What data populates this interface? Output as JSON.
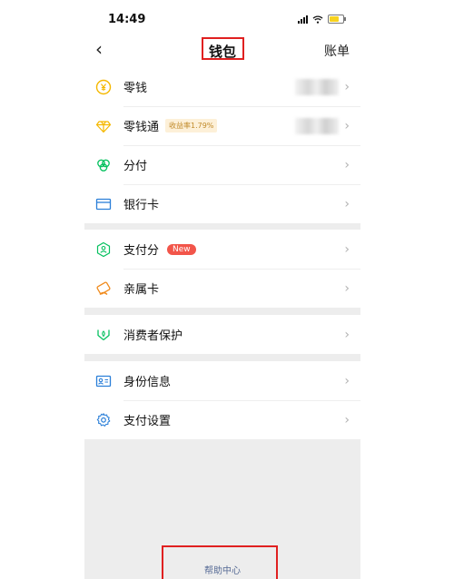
{
  "status_bar": {
    "time": "14:49"
  },
  "nav": {
    "back": "‹",
    "title": "钱包",
    "right": "账单"
  },
  "chevron": "›",
  "sections": [
    {
      "items": [
        {
          "label": "零钱",
          "icon": "yen-coin-icon"
        },
        {
          "label": "零钱通",
          "icon": "diamond-icon",
          "badge": "收益率1.79%"
        },
        {
          "label": "分付",
          "icon": "clover-icon"
        },
        {
          "label": "银行卡",
          "icon": "bank-card-icon"
        }
      ]
    },
    {
      "items": [
        {
          "label": "支付分",
          "icon": "score-hexagon-icon",
          "badge": "New"
        },
        {
          "label": "亲属卡",
          "icon": "family-card-icon"
        }
      ]
    },
    {
      "items": [
        {
          "label": "消费者保护",
          "icon": "protection-hands-icon"
        }
      ]
    },
    {
      "items": [
        {
          "label": "身份信息",
          "icon": "id-card-icon"
        },
        {
          "label": "支付设置",
          "icon": "settings-gear-icon"
        }
      ]
    }
  ],
  "footer": {
    "help": "帮助中心"
  },
  "colors": {
    "accent_green": "#07c160",
    "link_blue": "#576b95",
    "highlight_red": "#e02020",
    "badge_red": "#f2554a"
  }
}
